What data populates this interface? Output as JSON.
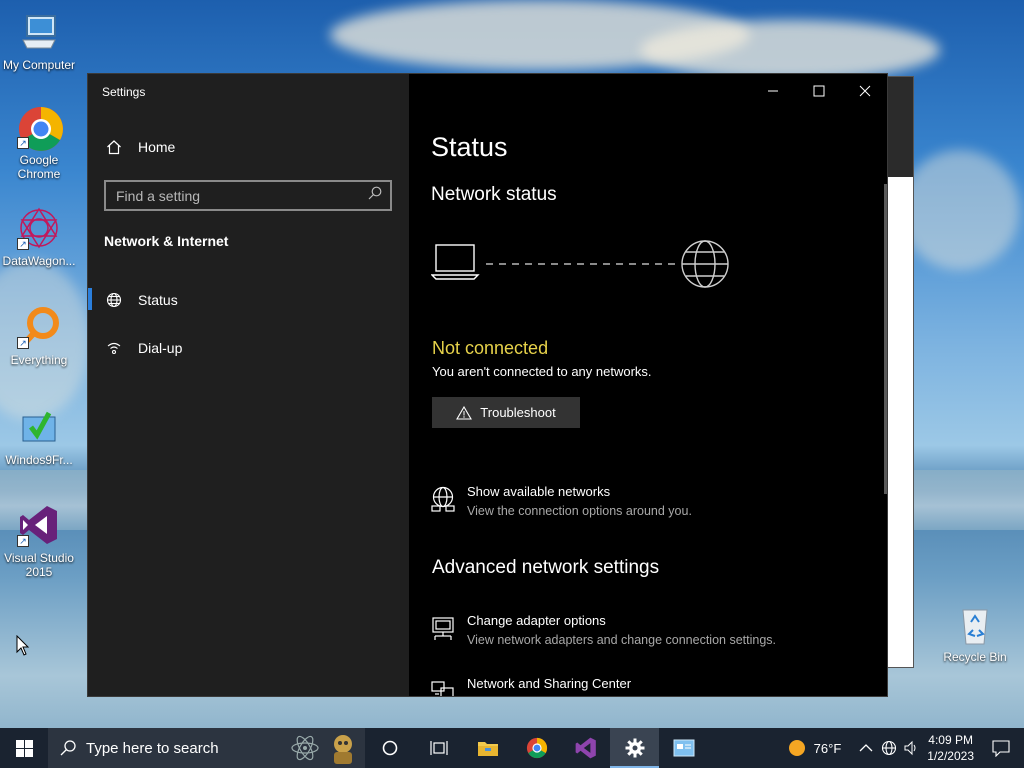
{
  "desktop": {
    "icons": [
      {
        "label": "My Computer"
      },
      {
        "label": "Google Chrome"
      },
      {
        "label": "DataWagon..."
      },
      {
        "label": "Everything"
      },
      {
        "label": "Windos9Fr..."
      },
      {
        "label": "Visual Studio 2015"
      },
      {
        "label": "Recycle Bin"
      }
    ]
  },
  "window": {
    "title": "Settings",
    "controls": {
      "minimize": "minimize",
      "maximize": "maximize",
      "close": "close"
    }
  },
  "sidebar": {
    "home_label": "Home",
    "search_placeholder": "Find a setting",
    "section_title": "Network & Internet",
    "items": [
      {
        "label": "Status",
        "icon": "globe-icon",
        "active": true
      },
      {
        "label": "Dial-up",
        "icon": "dialup-icon",
        "active": false
      }
    ]
  },
  "main": {
    "page_title": "Status",
    "network_status_heading": "Network status",
    "connection_state": "Not connected",
    "connection_detail": "You aren't connected to any networks.",
    "troubleshoot_label": "Troubleshoot",
    "show_networks": {
      "title": "Show available networks",
      "subtitle": "View the connection options around you."
    },
    "advanced_heading": "Advanced network settings",
    "change_adapter": {
      "title": "Change adapter options",
      "subtitle": "View network adapters and change connection settings."
    },
    "sharing_center": {
      "title": "Network and Sharing Center"
    }
  },
  "taskbar": {
    "search_placeholder": "Type here to search",
    "weather": "76°F",
    "time": "4:09 PM",
    "date": "1/2/2023"
  },
  "colors": {
    "accent": "#2b7fdc",
    "warning_text": "#e7d24a",
    "sidebar_bg": "#1f1f1f",
    "main_bg": "#000000"
  }
}
